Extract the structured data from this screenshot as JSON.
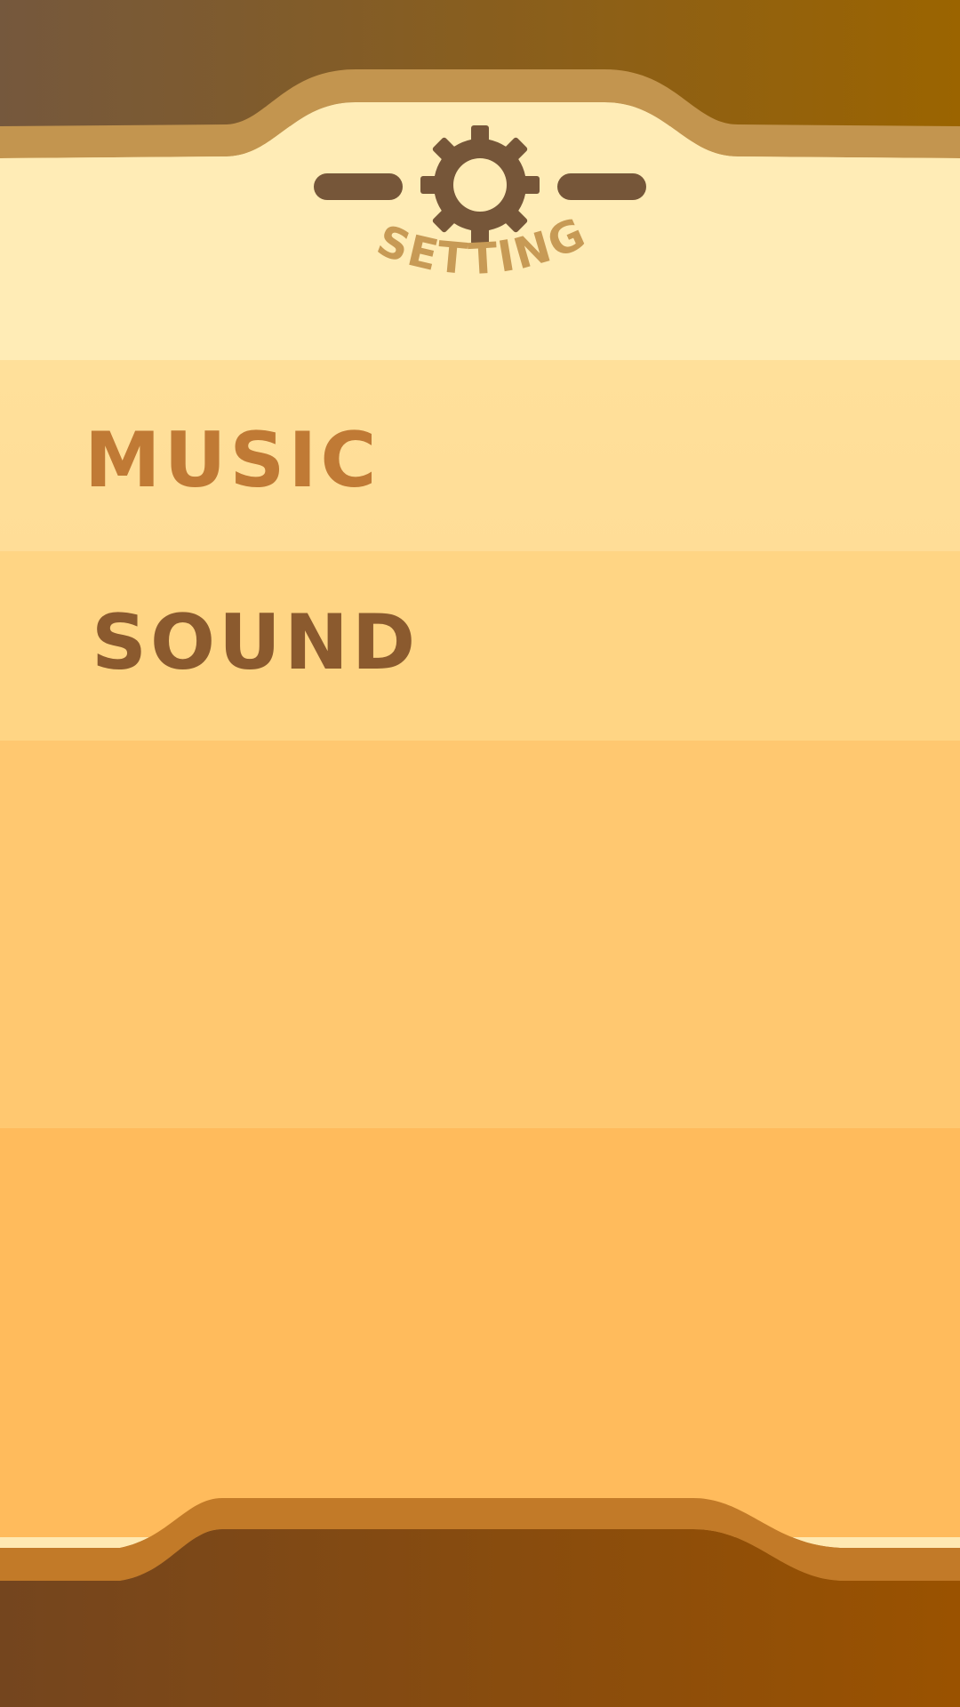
{
  "header": {
    "title": "SETTING",
    "icon": "gear-icon"
  },
  "settings": {
    "music_label": "MUSIC",
    "sound_label": "SOUND"
  },
  "colors": {
    "top_bar_left": "#75583d",
    "top_bar_right": "#9b6400",
    "trim": "#c3954f",
    "header_bg": "#ffecb6",
    "gear": "#765639",
    "music_text": "#c07a35",
    "sound_text": "#8b5a2e",
    "bottom_bar_left": "#74451e",
    "bottom_bar_right": "#9a5200",
    "bottom_trim": "#c27a28"
  }
}
